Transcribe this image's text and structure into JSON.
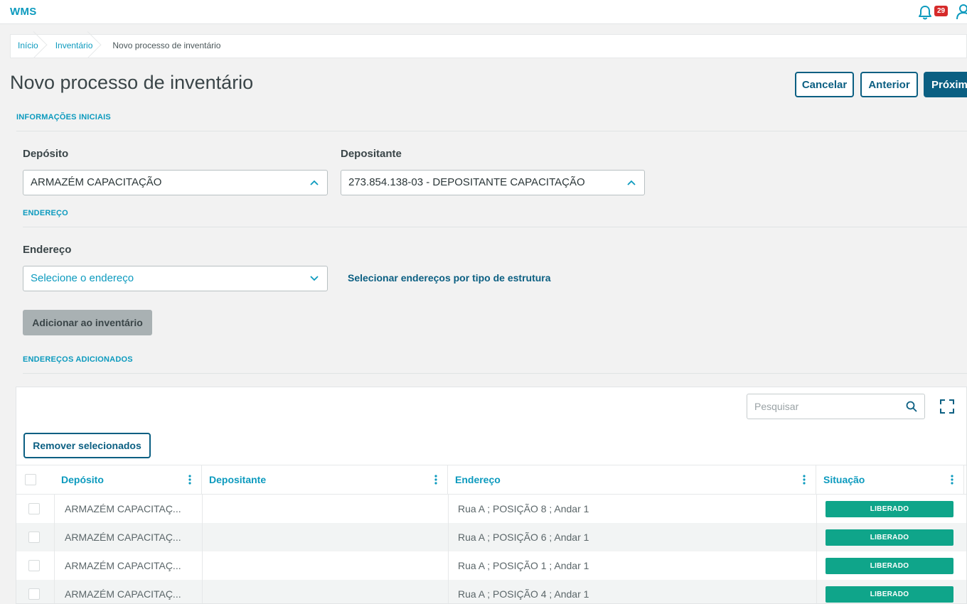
{
  "app": {
    "title": "WMS",
    "notifications_count": "29"
  },
  "breadcrumb": [
    "Início",
    "Inventário",
    "Novo processo de inventário"
  ],
  "page": {
    "title": "Novo processo de inventário"
  },
  "actions": {
    "cancel": "Cancelar",
    "previous": "Anterior",
    "next": "Próximo"
  },
  "sections": {
    "initial_info": "INFORMAÇÕES INICIAIS",
    "address": "ENDEREÇO",
    "added": "ENDEREÇOS ADICIONADOS"
  },
  "fields": {
    "deposito": {
      "label": "Depósito",
      "value": "ARMAZÉM CAPACITAÇÃO"
    },
    "depositante": {
      "label": "Depositante",
      "value": "273.854.138-03 - DEPOSITANTE CAPACITAÇÃO"
    },
    "endereco": {
      "label": "Endereço",
      "placeholder": "Selecione o endereço"
    }
  },
  "links": {
    "select_by_structure": "Selecionar endereços por tipo de estrutura"
  },
  "buttons": {
    "add_to_inventory": "Adicionar ao inventário",
    "remove_selected": "Remover selecionados"
  },
  "table": {
    "search_placeholder": "Pesquisar",
    "columns": [
      "Depósito",
      "Depositante",
      "Endereço",
      "Situação"
    ],
    "rows": [
      {
        "deposito": "ARMAZÉM CAPACITAÇ...",
        "depositante": "",
        "endereco": "Rua A ; POSIÇÃO 8 ; Andar 1",
        "situacao": "LIBERADO"
      },
      {
        "deposito": "ARMAZÉM CAPACITAÇ...",
        "depositante": "",
        "endereco": "Rua A ; POSIÇÃO 6 ; Andar 1",
        "situacao": "LIBERADO"
      },
      {
        "deposito": "ARMAZÉM CAPACITAÇ...",
        "depositante": "",
        "endereco": "Rua A ; POSIÇÃO 1 ; Andar 1",
        "situacao": "LIBERADO"
      },
      {
        "deposito": "ARMAZÉM CAPACITAÇ...",
        "depositante": "",
        "endereco": "Rua A ; POSIÇÃO 4 ; Andar 1",
        "situacao": "LIBERADO"
      }
    ]
  },
  "colors": {
    "accent": "#0c9abe",
    "primary": "#0b5f82",
    "status_ok": "#0fa58a",
    "badge": "#d62a2a"
  },
  "icons": [
    "bell-icon",
    "user-icon",
    "chevron-up-icon",
    "chevron-down-icon",
    "search-icon",
    "expand-icon",
    "more-vertical-icon"
  ]
}
